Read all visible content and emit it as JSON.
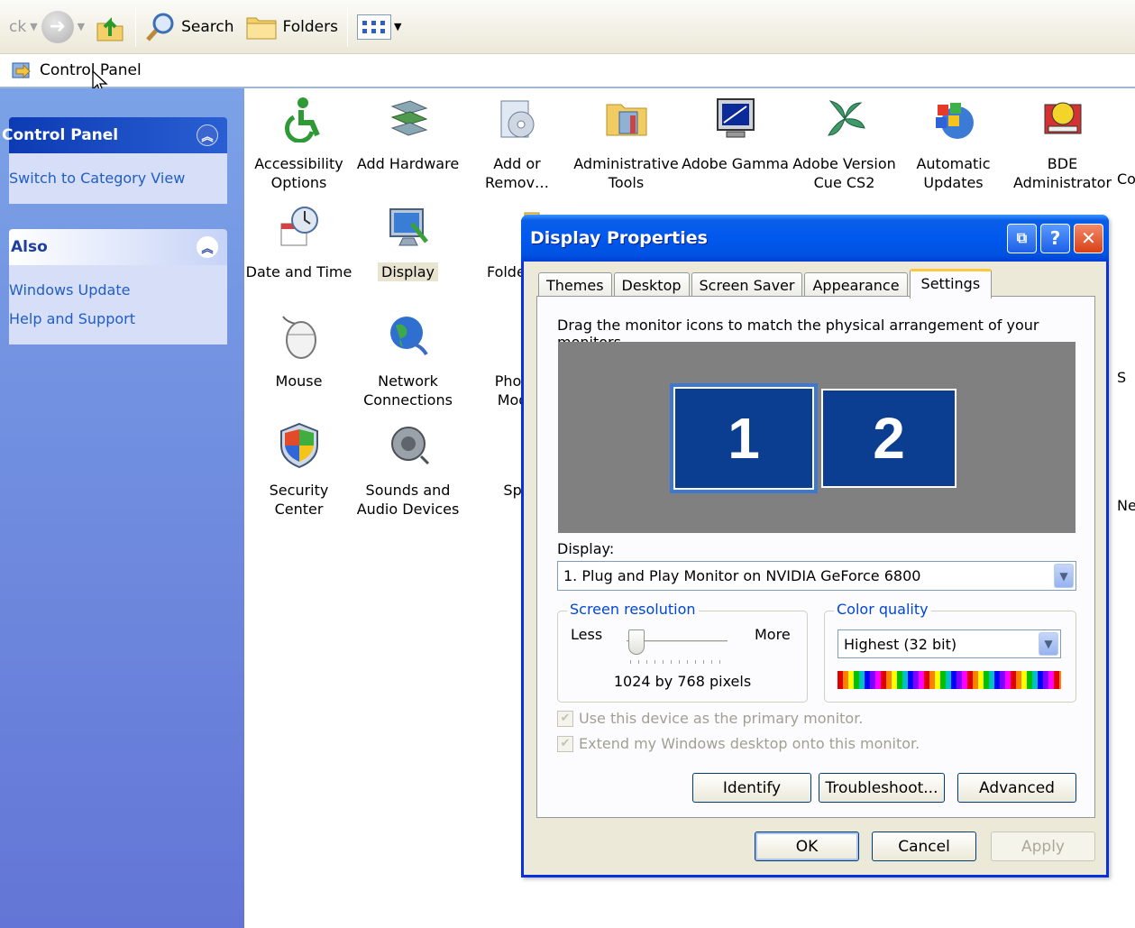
{
  "toolbar": {
    "back_label": "ck",
    "search_label": "Search",
    "folders_label": "Folders"
  },
  "address": {
    "value": "Control Panel"
  },
  "taskpane": {
    "panel1": {
      "title": "Control Panel",
      "links": [
        "Switch to Category View"
      ]
    },
    "panel2": {
      "title": "Also",
      "links": [
        "Windows Update",
        "Help and Support"
      ]
    }
  },
  "icons": [
    {
      "label": "Accessibility\nOptions",
      "icon": "accessibility-icon"
    },
    {
      "label": "Add Hardware",
      "icon": "add-hardware-icon"
    },
    {
      "label": "Add or\nRemov…",
      "icon": "add-remove-programs-icon"
    },
    {
      "label": "Administrative\nTools",
      "icon": "administrative-tools-icon"
    },
    {
      "label": "Adobe Gamma",
      "icon": "adobe-gamma-icon"
    },
    {
      "label": "Adobe Version\nCue CS2",
      "icon": "adobe-version-cue-icon"
    },
    {
      "label": "Automatic\nUpdates",
      "icon": "automatic-updates-icon"
    },
    {
      "label": "BDE\nAdministrator",
      "icon": "bde-administrator-icon"
    },
    {
      "label": "Date and Time",
      "icon": "date-time-icon"
    },
    {
      "label": "Display",
      "icon": "display-icon"
    },
    {
      "label": "Folder O",
      "icon": "folder-options-icon"
    },
    {
      "label": "Mouse",
      "icon": "mouse-icon"
    },
    {
      "label": "Network\nConnections",
      "icon": "network-connections-icon"
    },
    {
      "label": "Phone\nMode",
      "icon": "phone-modem-icon"
    },
    {
      "label": "Security\nCenter",
      "icon": "security-center-icon"
    },
    {
      "label": "Sounds and\nAudio Devices",
      "icon": "sounds-audio-icon"
    },
    {
      "label": "Spe",
      "icon": "speech-icon"
    }
  ],
  "edge_labels": [
    "Co",
    "S",
    "Ne"
  ],
  "dialog": {
    "title": "Display Properties",
    "tabs": [
      "Themes",
      "Desktop",
      "Screen Saver",
      "Appearance",
      "Settings"
    ],
    "active_tab": "Settings",
    "instruction": "Drag the monitor icons to match the physical arrangement of your monitors.",
    "monitors": [
      "1",
      "2"
    ],
    "display_label": "Display:",
    "display_value": "1. Plug and Play Monitor on NVIDIA GeForce 6800",
    "resolution": {
      "title": "Screen resolution",
      "less": "Less",
      "more": "More",
      "value": "1024 by 768 pixels"
    },
    "color_quality": {
      "title": "Color quality",
      "value": "Highest (32 bit)"
    },
    "checkboxes": [
      "Use this device as the primary monitor.",
      "Extend my Windows desktop onto this monitor."
    ],
    "buttons": {
      "identify": "Identify",
      "troubleshoot": "Troubleshoot...",
      "advanced": "Advanced",
      "ok": "OK",
      "cancel": "Cancel",
      "apply": "Apply"
    }
  }
}
